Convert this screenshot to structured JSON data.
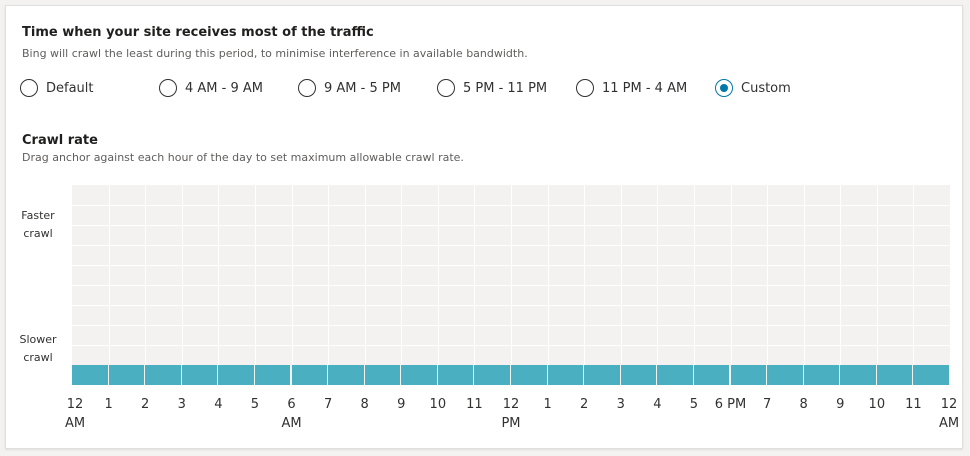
{
  "traffic": {
    "title": "Time when your site receives most of the traffic",
    "subtitle": "Bing will crawl the least during this period, to minimise interference in available bandwidth.",
    "options": [
      {
        "label": "Default",
        "checked": false
      },
      {
        "label": "4 AM - 9 AM",
        "checked": false
      },
      {
        "label": "9 AM - 5 PM",
        "checked": false
      },
      {
        "label": "5 PM - 11 PM",
        "checked": false
      },
      {
        "label": "11 PM - 4 AM",
        "checked": false
      },
      {
        "label": "Custom",
        "checked": true
      }
    ],
    "selected": "Custom"
  },
  "crawl": {
    "title": "Crawl rate",
    "subtitle": "Drag anchor against each hour of the day to set maximum allowable crawl rate.",
    "faster_line1": "Faster",
    "faster_line2": "crawl",
    "slower_line1": "Slower",
    "slower_line2": "crawl",
    "bar_color": "#4aafc0"
  },
  "chart_data": {
    "type": "bar",
    "categories": [
      "12 AM",
      "1",
      "2",
      "3",
      "4",
      "5",
      "6 AM",
      "7",
      "8",
      "9",
      "10",
      "11",
      "12 PM",
      "1",
      "2",
      "3",
      "4",
      "5",
      "6 PM",
      "7",
      "8",
      "9",
      "10",
      "11"
    ],
    "values": [
      1,
      1,
      1,
      1,
      1,
      1,
      1,
      1,
      1,
      1,
      1,
      1,
      1,
      1,
      1,
      1,
      1,
      1,
      1,
      1,
      1,
      1,
      1,
      1
    ],
    "ylim": [
      0,
      10
    ],
    "ylabel_top": "Faster crawl",
    "ylabel_bottom": "Slower crawl",
    "grid": true
  },
  "ticks": [
    {
      "line1": "12",
      "line2": "AM"
    },
    {
      "line1": "1",
      "line2": ""
    },
    {
      "line1": "2",
      "line2": ""
    },
    {
      "line1": "3",
      "line2": ""
    },
    {
      "line1": "4",
      "line2": ""
    },
    {
      "line1": "5",
      "line2": ""
    },
    {
      "line1": "6",
      "line2": "AM"
    },
    {
      "line1": "7",
      "line2": ""
    },
    {
      "line1": "8",
      "line2": ""
    },
    {
      "line1": "9",
      "line2": ""
    },
    {
      "line1": "10",
      "line2": ""
    },
    {
      "line1": "11",
      "line2": ""
    },
    {
      "line1": "12",
      "line2": "PM"
    },
    {
      "line1": "1",
      "line2": ""
    },
    {
      "line1": "2",
      "line2": ""
    },
    {
      "line1": "3",
      "line2": ""
    },
    {
      "line1": "4",
      "line2": ""
    },
    {
      "line1": "5",
      "line2": ""
    },
    {
      "line1": "6 PM",
      "line2": ""
    },
    {
      "line1": "7",
      "line2": ""
    },
    {
      "line1": "8",
      "line2": ""
    },
    {
      "line1": "9",
      "line2": ""
    },
    {
      "line1": "10",
      "line2": ""
    },
    {
      "line1": "11",
      "line2": ""
    },
    {
      "line1": "12",
      "line2": "AM"
    }
  ]
}
